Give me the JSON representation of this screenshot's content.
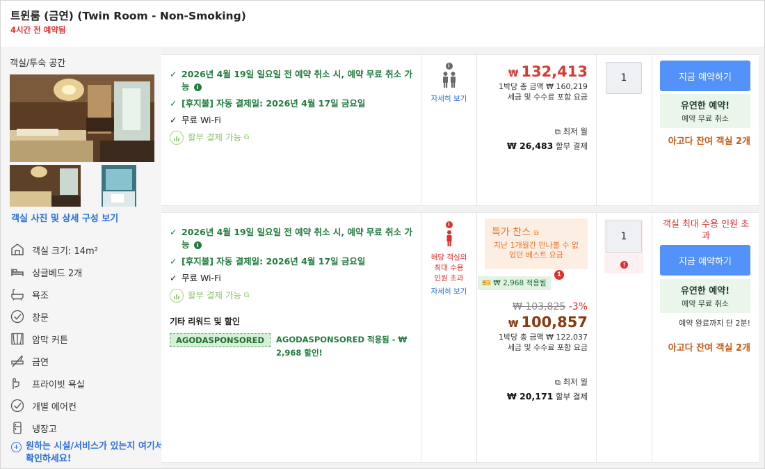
{
  "header": {
    "title": "트윈룸 (금연) (Twin Room - Non-Smoking)",
    "booked_note": "4시간 전 예약됨"
  },
  "left_panel": {
    "section_title": "객실/투숙 공간",
    "photos_link": "객실 사진 및 상세 구성 보기",
    "amenities": [
      {
        "icon": "room-size-icon",
        "label": "객실 크기: 14m²"
      },
      {
        "icon": "bed-icon",
        "label": "싱글베드 2개"
      },
      {
        "icon": "bathtub-icon",
        "label": "욕조"
      },
      {
        "icon": "check-circle-icon",
        "label": "창문"
      },
      {
        "icon": "blackout-curtain-icon",
        "label": "암막 커튼"
      },
      {
        "icon": "no-smoking-icon",
        "label": "금연"
      },
      {
        "icon": "shower-icon",
        "label": "프라이빗 욕실"
      },
      {
        "icon": "check-circle-icon",
        "label": "개별 에어컨"
      },
      {
        "icon": "fridge-icon",
        "label": "냉장고"
      }
    ],
    "facilities_link": "원하는 시설/서비스가 있는지 여기서 확인하세요!"
  },
  "offers": [
    {
      "benefits": {
        "cancel": "2026년 4월 19일 일요일 전 예약 취소 시, 예약 무료 취소 가능",
        "pay_later": "[후지불] 자동 결제일: 2026년 4월 17일 금요일",
        "wifi": "무료 Wi-Fi",
        "installment": "할부 결제 가능"
      },
      "occupancy": {
        "details": "자세히 보기"
      },
      "price": {
        "currency": "₩",
        "amount": "132,413",
        "total_line": "1박당 총 금액 ₩ 160,219",
        "tax_line": "세금 및 수수료 포함 요금",
        "monthly_label": "최저 월",
        "monthly_amount": "₩ 26,483",
        "monthly_suffix": "할부 결제"
      },
      "quantity": "1",
      "book_button": "지금 예약하기",
      "flex": {
        "title": "유연한 예약!",
        "sub": "예약 무료 취소"
      },
      "rooms_left": "아고다 잔여 객실 2개"
    },
    {
      "benefits": {
        "cancel": "2026년 4월 19일 일요일 전 예약 취소 시, 예약 무료 취소 가능",
        "pay_later": "[후지불] 자동 결제일: 2026년 4월 17일 금요일",
        "wifi": "무료 Wi-Fi",
        "installment": "할부 결제 가능",
        "rewards_title": "기타 리워드 및 할인",
        "coupon_code": "AGODASPONSORED",
        "coupon_text": "AGODASPONSORED 적용됨 - ₩ 2,968 할인!"
      },
      "occupancy": {
        "warning": "해당 객실의 최대 수용 인원 초과",
        "details": "자세히 보기"
      },
      "deal": {
        "title": "특가 찬스",
        "desc": "지난 1개월간 만나볼 수 없었던 베스트 요금"
      },
      "coupon_badge": {
        "text": "₩ 2,968 적용됨",
        "count": "1"
      },
      "price": {
        "currency": "₩",
        "original": "₩ 103,825",
        "discount": "-3%",
        "amount": "100,857",
        "total_line": "1박당 총 금액 ₩ 122,037",
        "tax_line": "세금 및 수수료 포함 요금",
        "monthly_label": "최저 월",
        "monthly_amount": "₩ 20,171",
        "monthly_suffix": "할부 결제"
      },
      "quantity": "1",
      "capacity_warning": "객실 최대 수용 인원 초과",
      "book_button": "지금 예약하기",
      "flex": {
        "title": "유연한 예약!",
        "sub": "예약 무료 취소"
      },
      "time_note": "예약 완료까지 단 2분!",
      "rooms_left": "아고다 잔여 객실 2개"
    }
  ],
  "colors": {
    "brand_blue": "#5392f9",
    "price_red": "#d63a32",
    "price_brown": "#8a3a10",
    "benefit_green": "#227b3f",
    "warning_red": "#e12d2d",
    "rooms_left_orange": "#c45a14"
  }
}
